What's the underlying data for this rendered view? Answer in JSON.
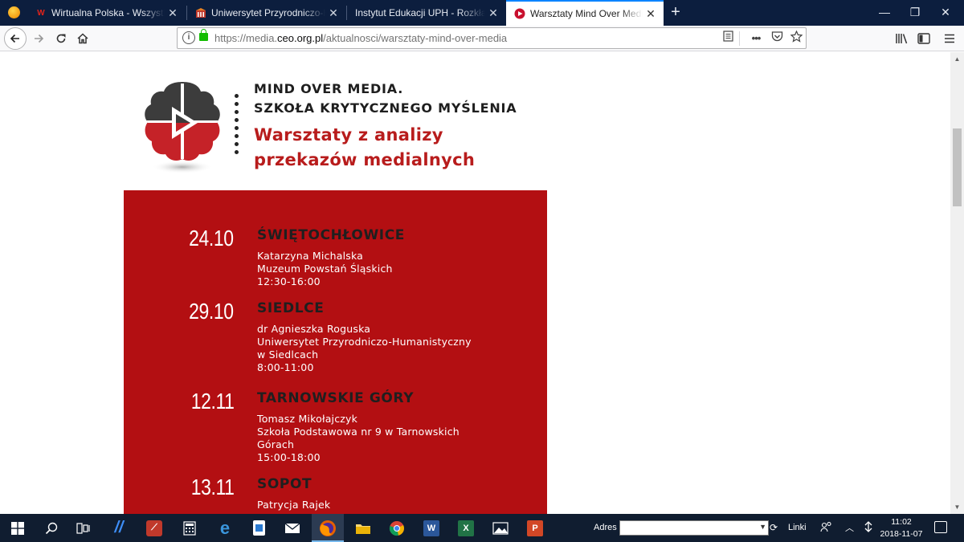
{
  "browser": {
    "tabs": [
      {
        "title": "Wirtualna Polska - Wszystko co",
        "favicon": "wp-icon",
        "active": false
      },
      {
        "title": "Uniwersytet Przyrodniczo-Hum",
        "favicon": "uph-icon",
        "active": false
      },
      {
        "title": "Instytut Edukacji UPH - Rozkłady za",
        "favicon": "none",
        "active": false
      },
      {
        "title": "Warsztaty Mind Over Media | M",
        "favicon": "ceo-icon",
        "active": true
      }
    ],
    "close_glyph": "✕",
    "new_tab_glyph": "+",
    "window": {
      "minimize": "—",
      "restore": "❐",
      "close": "✕"
    },
    "url_prefix": "https://media.",
    "url_domain": "ceo.org.pl",
    "url_path": "/aktualnosci/warsztaty-mind-over-media",
    "url_more": "•••"
  },
  "page": {
    "brand_line1": "MIND OVER MEDIA.",
    "brand_line2": "SZKOŁA KRYTYCZNEGO MYŚLENIA",
    "subtitle_line1": "Warsztaty z analizy",
    "subtitle_line2": "przekazów medialnych",
    "events": [
      {
        "date": "24.10",
        "city": "ŚWIĘTOCHŁOWICE",
        "lines": [
          "Katarzyna Michalska",
          "Muzeum Powstań Śląskich",
          "12:30-16:00"
        ]
      },
      {
        "date": "29.10",
        "city": "SIEDLCE",
        "lines": [
          "dr Agnieszka Roguska",
          "Uniwersytet Przyrodniczo-Humanistyczny",
          "w Siedlcach",
          "8:00-11:00"
        ]
      },
      {
        "date": "12.11",
        "city": "TARNOWSKIE GÓRY",
        "lines": [
          "Tomasz Mikołajczyk",
          "Szkoła Podstawowa nr 9 w Tarnowskich",
          "Górach",
          "15:00-18:00"
        ]
      },
      {
        "date": "13.11",
        "city": "SOPOT",
        "lines": [
          "Patrycja Rajek"
        ]
      }
    ]
  },
  "taskbar": {
    "adres_label": "Adres",
    "linki_label": "Linki",
    "time": "11:02",
    "date": "2018-11-07",
    "colors": {
      "word": "#2b579a",
      "excel": "#217346",
      "powerpoint": "#d24726",
      "chrome": "#4285f4"
    }
  }
}
